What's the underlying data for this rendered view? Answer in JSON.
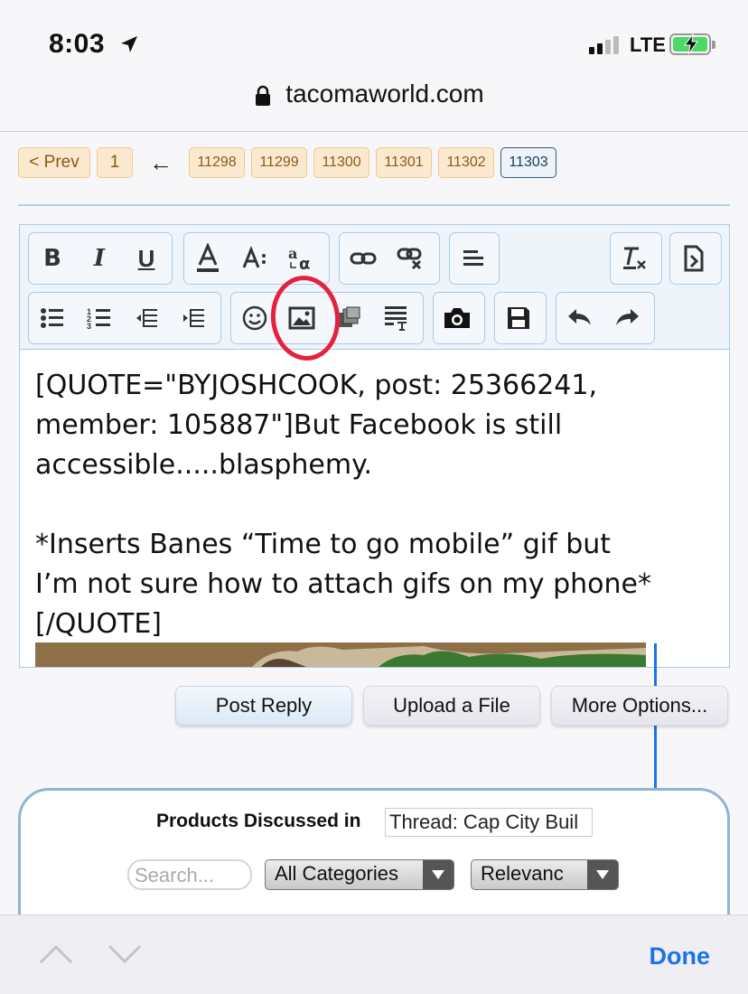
{
  "status_bar": {
    "time": "8:03",
    "carrier": "LTE"
  },
  "browser": {
    "url": "tacomaworld.com"
  },
  "pagination": {
    "prev_label": "< Prev",
    "first_page": "1",
    "ellipsis_arrow": "←",
    "pages": [
      "11298",
      "11299",
      "11300",
      "11301",
      "11302"
    ],
    "current_page": "11303"
  },
  "editor": {
    "toolbar_row1": [
      "bold-icon",
      "italic-icon",
      "underline-icon",
      "text-color-icon",
      "font-size-icon",
      "font-family-icon",
      "link-icon",
      "unlink-icon",
      "align-icon",
      "remove-format-icon",
      "toggle-bbcode-icon"
    ],
    "toolbar_row2": [
      "bullet-list-icon",
      "numbered-list-icon",
      "outdent-icon",
      "indent-icon",
      "smilie-icon",
      "image-icon",
      "media-icon",
      "quote-icon",
      "camera-icon",
      "save-draft-icon",
      "undo-icon",
      "redo-icon"
    ],
    "bold_glyph": "B",
    "italic_glyph": "I",
    "underline_glyph": "U",
    "content": "[QUOTE=\"BYJOSHCOOK, post: 25366241,\nmember: 105887\"]But Facebook is still\naccessible.....blasphemy.\n\n*Inserts Banes “Time to go mobile” gif but\nI’m not sure how to attach gifs on my phone*\n[/QUOTE]"
  },
  "actions": {
    "post_reply": "Post Reply",
    "upload_file": "Upload a File",
    "more_options": "More Options..."
  },
  "products": {
    "label": "Products Discussed in",
    "thread_value": "Thread: Cap City Buil",
    "search_placeholder": "Search...",
    "category_select": "All Categories",
    "sort_select": "Relevanc"
  },
  "accessory": {
    "done_label": "Done"
  },
  "colors": {
    "accent": "#1a73e8",
    "annotation": "#e6213d",
    "page_button": "#fbe9cf",
    "editor_border": "#a9cbe6"
  }
}
